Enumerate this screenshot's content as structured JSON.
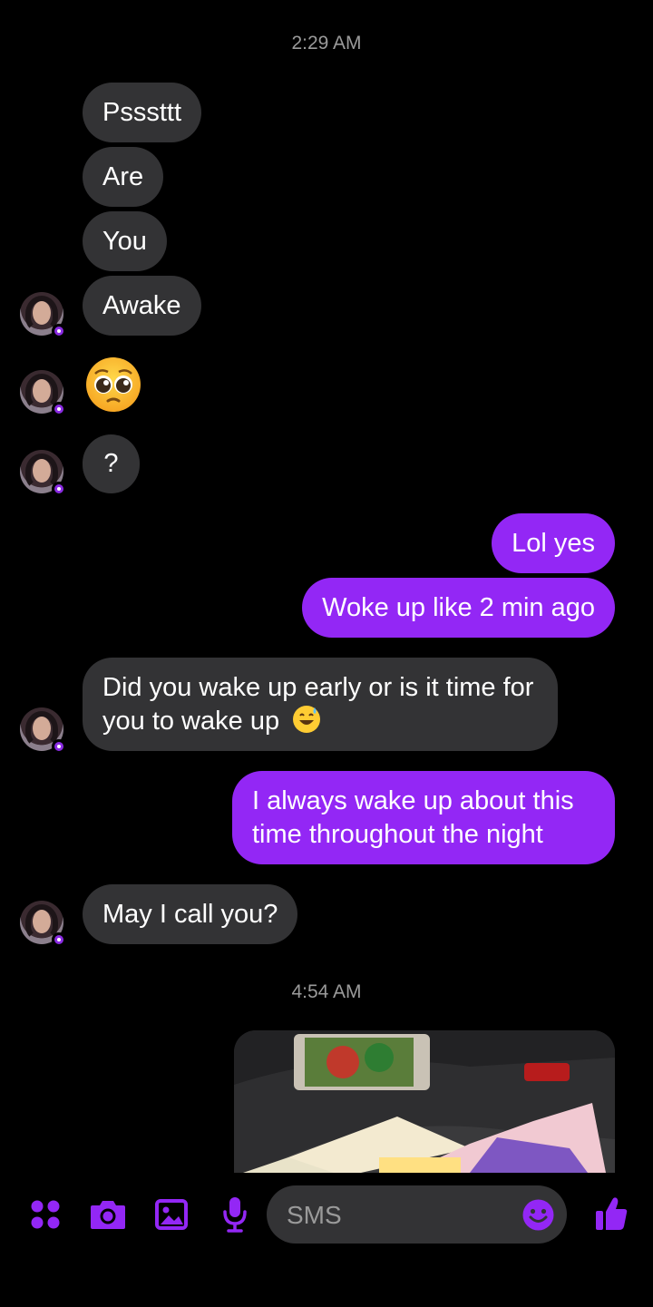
{
  "timestamps": [
    "2:29 AM",
    "4:54 AM"
  ],
  "incoming_1": [
    "Psssttt",
    "Are",
    "You",
    "Awake"
  ],
  "incoming_question": "?",
  "outgoing_1": [
    "Lol yes",
    "Woke up like 2 min ago"
  ],
  "incoming_2": "Did you wake up early or is it time for you to wake up",
  "outgoing_2": "I always wake up about this time throughout the night",
  "incoming_3": "May I call you?",
  "composer": {
    "placeholder": "SMS",
    "icons": [
      "apps-icon",
      "camera-icon",
      "gallery-icon",
      "microphone-icon",
      "emoji-icon",
      "thumbs-up-icon"
    ]
  },
  "colors": {
    "accent": "#9327f5",
    "incoming_bubble": "#333335",
    "background": "#000000"
  }
}
